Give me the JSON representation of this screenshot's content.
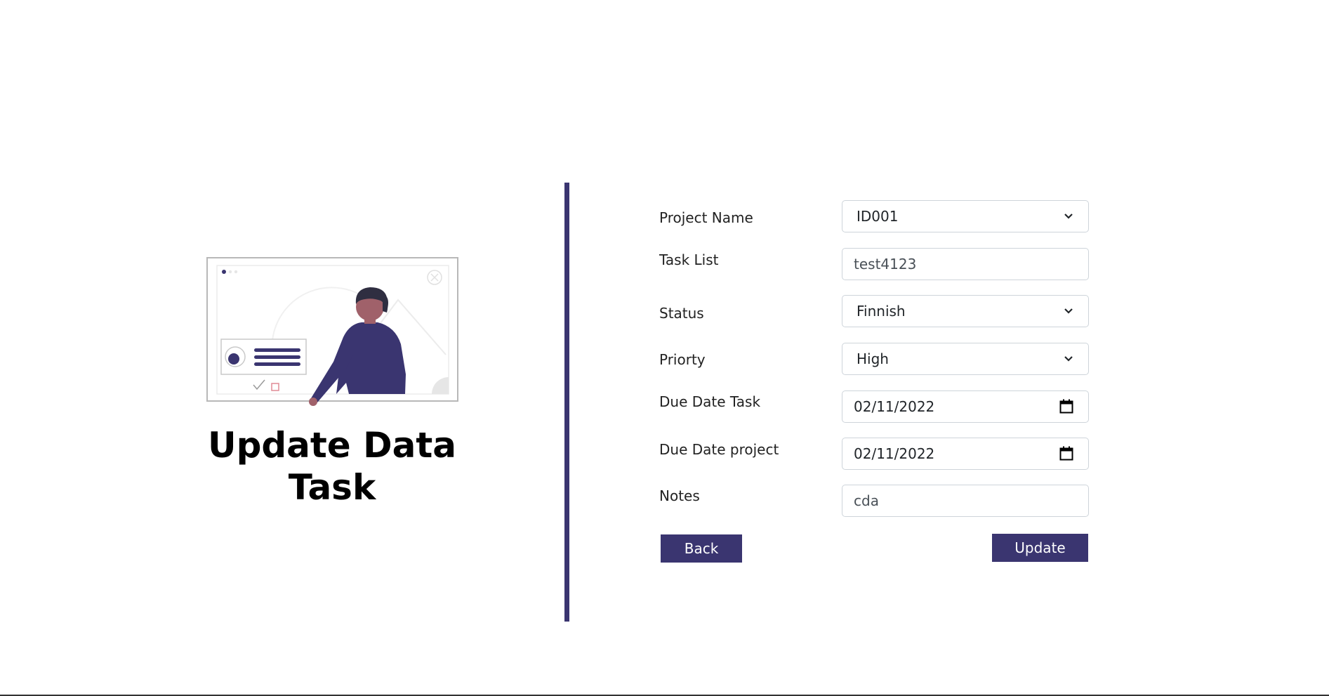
{
  "headline": {
    "line1": "Update Data",
    "line2": "Task"
  },
  "form": {
    "project_name": {
      "label": "Project Name",
      "value": "ID001"
    },
    "task_list": {
      "label": "Task List",
      "value": "test4123"
    },
    "status": {
      "label": "Status",
      "value": "Finnish"
    },
    "priority": {
      "label": "Priorty",
      "value": "High"
    },
    "due_date_task": {
      "label": "Due Date Task",
      "value": "02/11/2022"
    },
    "due_date_project": {
      "label": "Due Date project",
      "value": "02/11/2022"
    },
    "notes": {
      "label": "Notes",
      "value": "cda"
    }
  },
  "buttons": {
    "back": "Back",
    "update": "Update"
  },
  "colors": {
    "accent": "#3a3570",
    "skin": "#a0616a",
    "hair": "#2f2e41"
  },
  "icons": {
    "select": "chevron-down-icon",
    "date": "calendar-icon"
  }
}
